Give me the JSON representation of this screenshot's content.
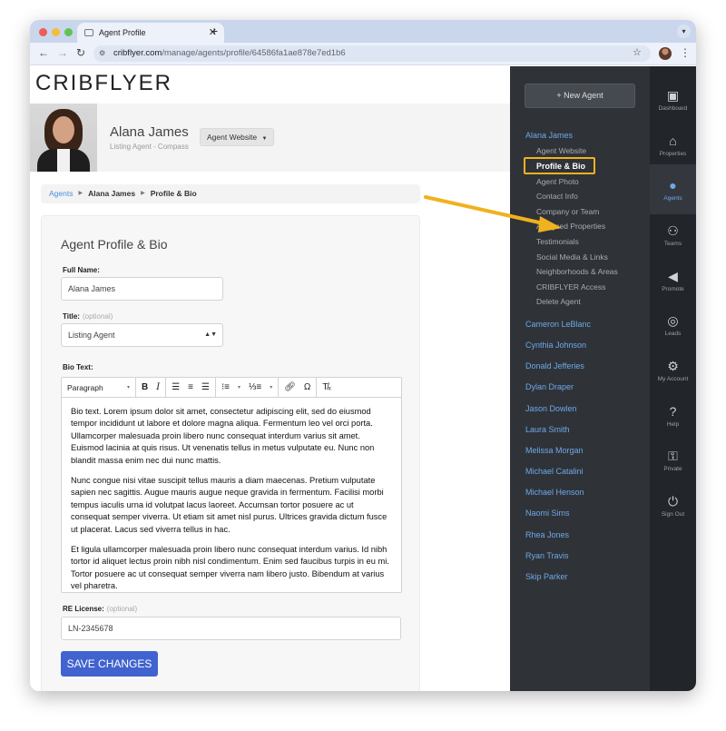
{
  "browser": {
    "tab_title": "Agent Profile",
    "url_domain": "cribflyer.com",
    "url_path": "/manage/agents/profile/64586fa1ae878e7ed1b6"
  },
  "header": {
    "logo": "CRIBFLYER",
    "agent_name": "Alana James",
    "agent_subtitle": "Listing Agent - Compass",
    "website_dropdown": "Agent Website"
  },
  "breadcrumb": {
    "root": "Agents",
    "agent": "Alana James",
    "current": "Profile & Bio"
  },
  "form": {
    "title": "Agent Profile & Bio",
    "full_name_label": "Full Name:",
    "full_name_value": "Alana James",
    "title_label": "Title:",
    "title_optional": "(optional)",
    "title_value": "Listing Agent",
    "bio_label": "Bio Text:",
    "paragraph_select": "Paragraph",
    "bio_paragraphs": [
      "Bio text. Lorem ipsum dolor sit amet, consectetur adipiscing elit, sed do eiusmod tempor incididunt ut labore et dolore magna aliqua. Fermentum leo vel orci porta. Ullamcorper malesuada proin libero nunc consequat interdum varius sit amet. Euismod lacinia at quis risus. Ut venenatis tellus in metus vulputate eu. Nunc non blandit massa enim nec dui nunc mattis.",
      "Nunc congue nisi vitae suscipit tellus mauris a diam maecenas. Pretium vulputate sapien nec sagittis. Augue mauris augue neque gravida in fermentum. Facilisi morbi tempus iaculis urna id volutpat lacus laoreet. Accumsan tortor posuere ac ut consequat semper viverra. Ut etiam sit amet nisl purus. Ultrices gravida dictum fusce ut placerat. Lacus sed viverra tellus in hac.",
      "Et ligula ullamcorper malesuada proin libero nunc consequat interdum varius. Id nibh tortor id aliquet lectus proin nibh nisl condimentum. Enim sed faucibus turpis in eu mi. Tortor posuere ac ut consequat semper viverra nam libero justo. Bibendum at varius vel pharetra."
    ],
    "license_label": "RE License:",
    "license_optional": "(optional)",
    "license_value": "LN-2345678",
    "save_label": "SAVE CHANGES"
  },
  "sidebar": {
    "new_agent": "+ New Agent",
    "current_agent": "Alana James",
    "sub_items": [
      "Agent Website",
      "Profile & Bio",
      "Agent Photo",
      "Contact Info",
      "Company or Team",
      "Assigned Properties",
      "Testimonials",
      "Social Media & Links",
      "Neighborhoods & Areas",
      "CRIBFLYER Access",
      "Delete Agent"
    ],
    "agents": [
      "Cameron LeBlanc",
      "Cynthia Johnson",
      "Donald Jefferies",
      "Dylan Draper",
      "Jason Dowlen",
      "Laura Smith",
      "Melissa Morgan",
      "Michael Catalini",
      "Michael Henson",
      "Naomi Sims",
      "Rhea Jones",
      "Ryan Travis",
      "Skip Parker"
    ]
  },
  "rail": [
    {
      "label": "Dashboard",
      "icon": "dashboard-icon"
    },
    {
      "label": "Properties",
      "icon": "properties-icon"
    },
    {
      "label": "Agents",
      "icon": "agents-icon"
    },
    {
      "label": "Teams",
      "icon": "teams-icon"
    },
    {
      "label": "Promote",
      "icon": "megaphone-icon"
    },
    {
      "label": "Leads",
      "icon": "target-icon"
    },
    {
      "label": "My Account",
      "icon": "gear-icon"
    },
    {
      "label": "Help",
      "icon": "help-icon"
    },
    {
      "label": "Private",
      "icon": "key-icon"
    },
    {
      "label": "Sign Out",
      "icon": "power-icon"
    }
  ],
  "colors": {
    "accent": "#4163cf",
    "link": "#6fa8e8",
    "sidebar": "#2f3338",
    "rail": "#222529",
    "highlight": "#f0b21e"
  }
}
